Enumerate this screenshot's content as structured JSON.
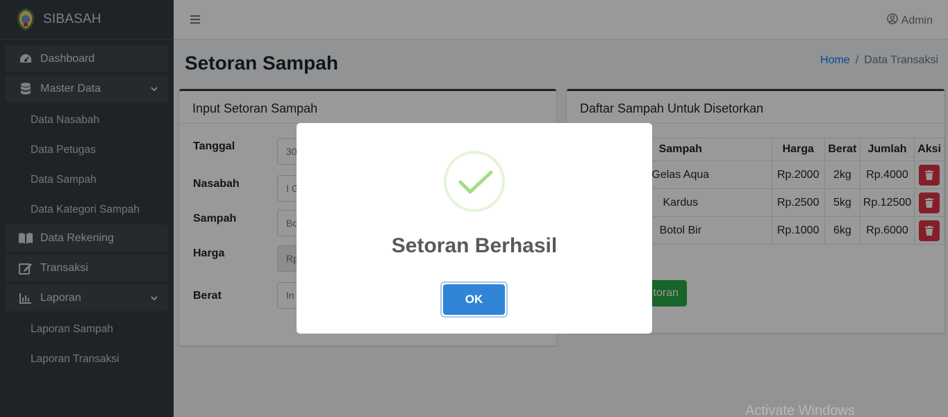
{
  "app": {
    "brand": "SIBASAH"
  },
  "sidebar": {
    "items": [
      {
        "label": "Dashboard",
        "icon": "tachometer-icon"
      },
      {
        "label": "Master Data",
        "icon": "database-icon"
      },
      {
        "label": "Data Nasabah"
      },
      {
        "label": "Data Petugas"
      },
      {
        "label": "Data Sampah"
      },
      {
        "label": "Data Kategori Sampah"
      },
      {
        "label": "Data Rekening",
        "icon": "book-icon"
      },
      {
        "label": "Transaksi",
        "icon": "edit-icon"
      },
      {
        "label": "Laporan",
        "icon": "chart-icon"
      },
      {
        "label": "Laporan Sampah"
      },
      {
        "label": "Laporan Transaksi"
      }
    ]
  },
  "topbar": {
    "user": "Admin"
  },
  "page": {
    "title": "Setoran Sampah",
    "breadcrumb": {
      "home": "Home",
      "sep": "/",
      "current": "Data Transaksi"
    }
  },
  "form": {
    "header": "Input Setoran Sampah",
    "fields": [
      {
        "label": "Tanggal",
        "value": "30"
      },
      {
        "label": "Nasabah",
        "value": "I G"
      },
      {
        "label": "Sampah",
        "value": "Bo"
      },
      {
        "label": "Harga",
        "value": "Rp"
      },
      {
        "label": "Berat",
        "value": "In"
      }
    ]
  },
  "list": {
    "header": "Daftar Sampah Untuk Disetorkan",
    "columns": [
      "Sampah",
      "Harga",
      "Berat",
      "Jumlah",
      "Aksi"
    ],
    "rows": [
      {
        "sampah": "Gelas Aqua",
        "harga": "Rp.2000",
        "berat": "2kg",
        "jumlah": "Rp.4000"
      },
      {
        "sampah": "Kardus",
        "harga": "Rp.2500",
        "berat": "5kg",
        "jumlah": "Rp.12500"
      },
      {
        "sampah": "Botol Bir",
        "harga": "Rp.1000",
        "berat": "6kg",
        "jumlah": "Rp.6000"
      }
    ],
    "save_label": "toran"
  },
  "modal": {
    "title": "Setoran Berhasil",
    "ok_label": "OK"
  },
  "watermark": "Activate Windows",
  "colors": {
    "sidebar": "#343a40",
    "accent": "#3085d6",
    "success": "#a5dc86",
    "danger": "#dc3545",
    "save": "#28a745"
  }
}
